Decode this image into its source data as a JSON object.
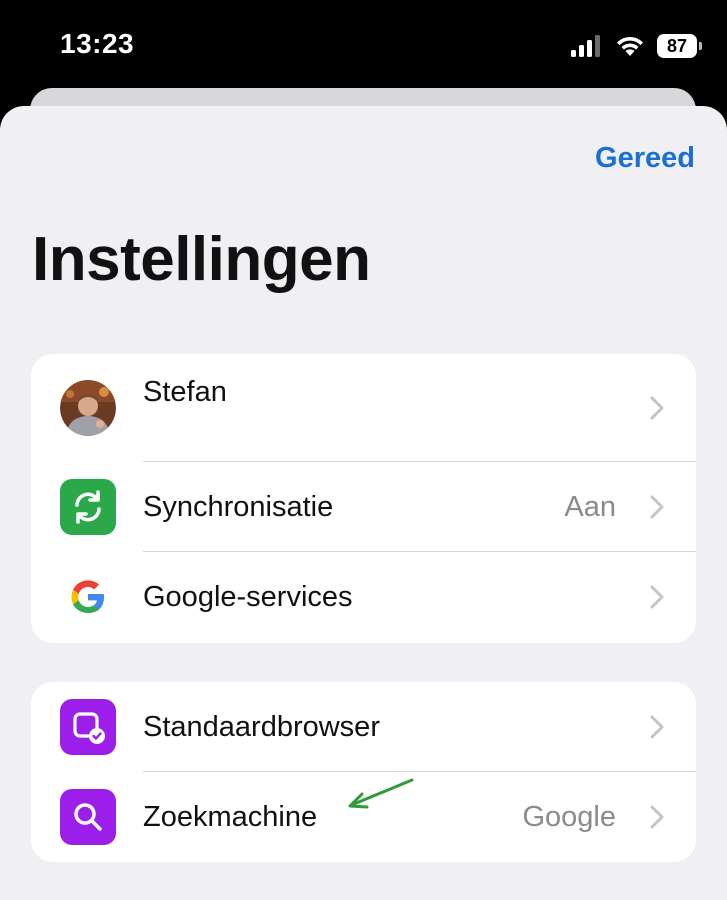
{
  "status_bar": {
    "time": "13:23",
    "battery": "87",
    "icons": [
      "signal-icon",
      "wifi-icon",
      "battery-icon"
    ]
  },
  "header": {
    "done_label": "Gereed",
    "title": "Instellingen"
  },
  "groups": [
    {
      "rows": [
        {
          "label": "Stefan",
          "value": "",
          "icon": "avatar"
        },
        {
          "label": "Synchronisatie",
          "value": "Aan",
          "icon": "sync-icon"
        },
        {
          "label": "Google-services",
          "value": "",
          "icon": "google-icon"
        }
      ]
    },
    {
      "rows": [
        {
          "label": "Standaardbrowser",
          "value": "",
          "icon": "default-browser-icon"
        },
        {
          "label": "Zoekmachine",
          "value": "Google",
          "icon": "search-icon"
        }
      ]
    }
  ],
  "colors": {
    "accent": "#1a6fd6",
    "sync_green": "#2aa84a",
    "purple": "#9b1fe8",
    "annotation_green": "#2e9a3a"
  }
}
